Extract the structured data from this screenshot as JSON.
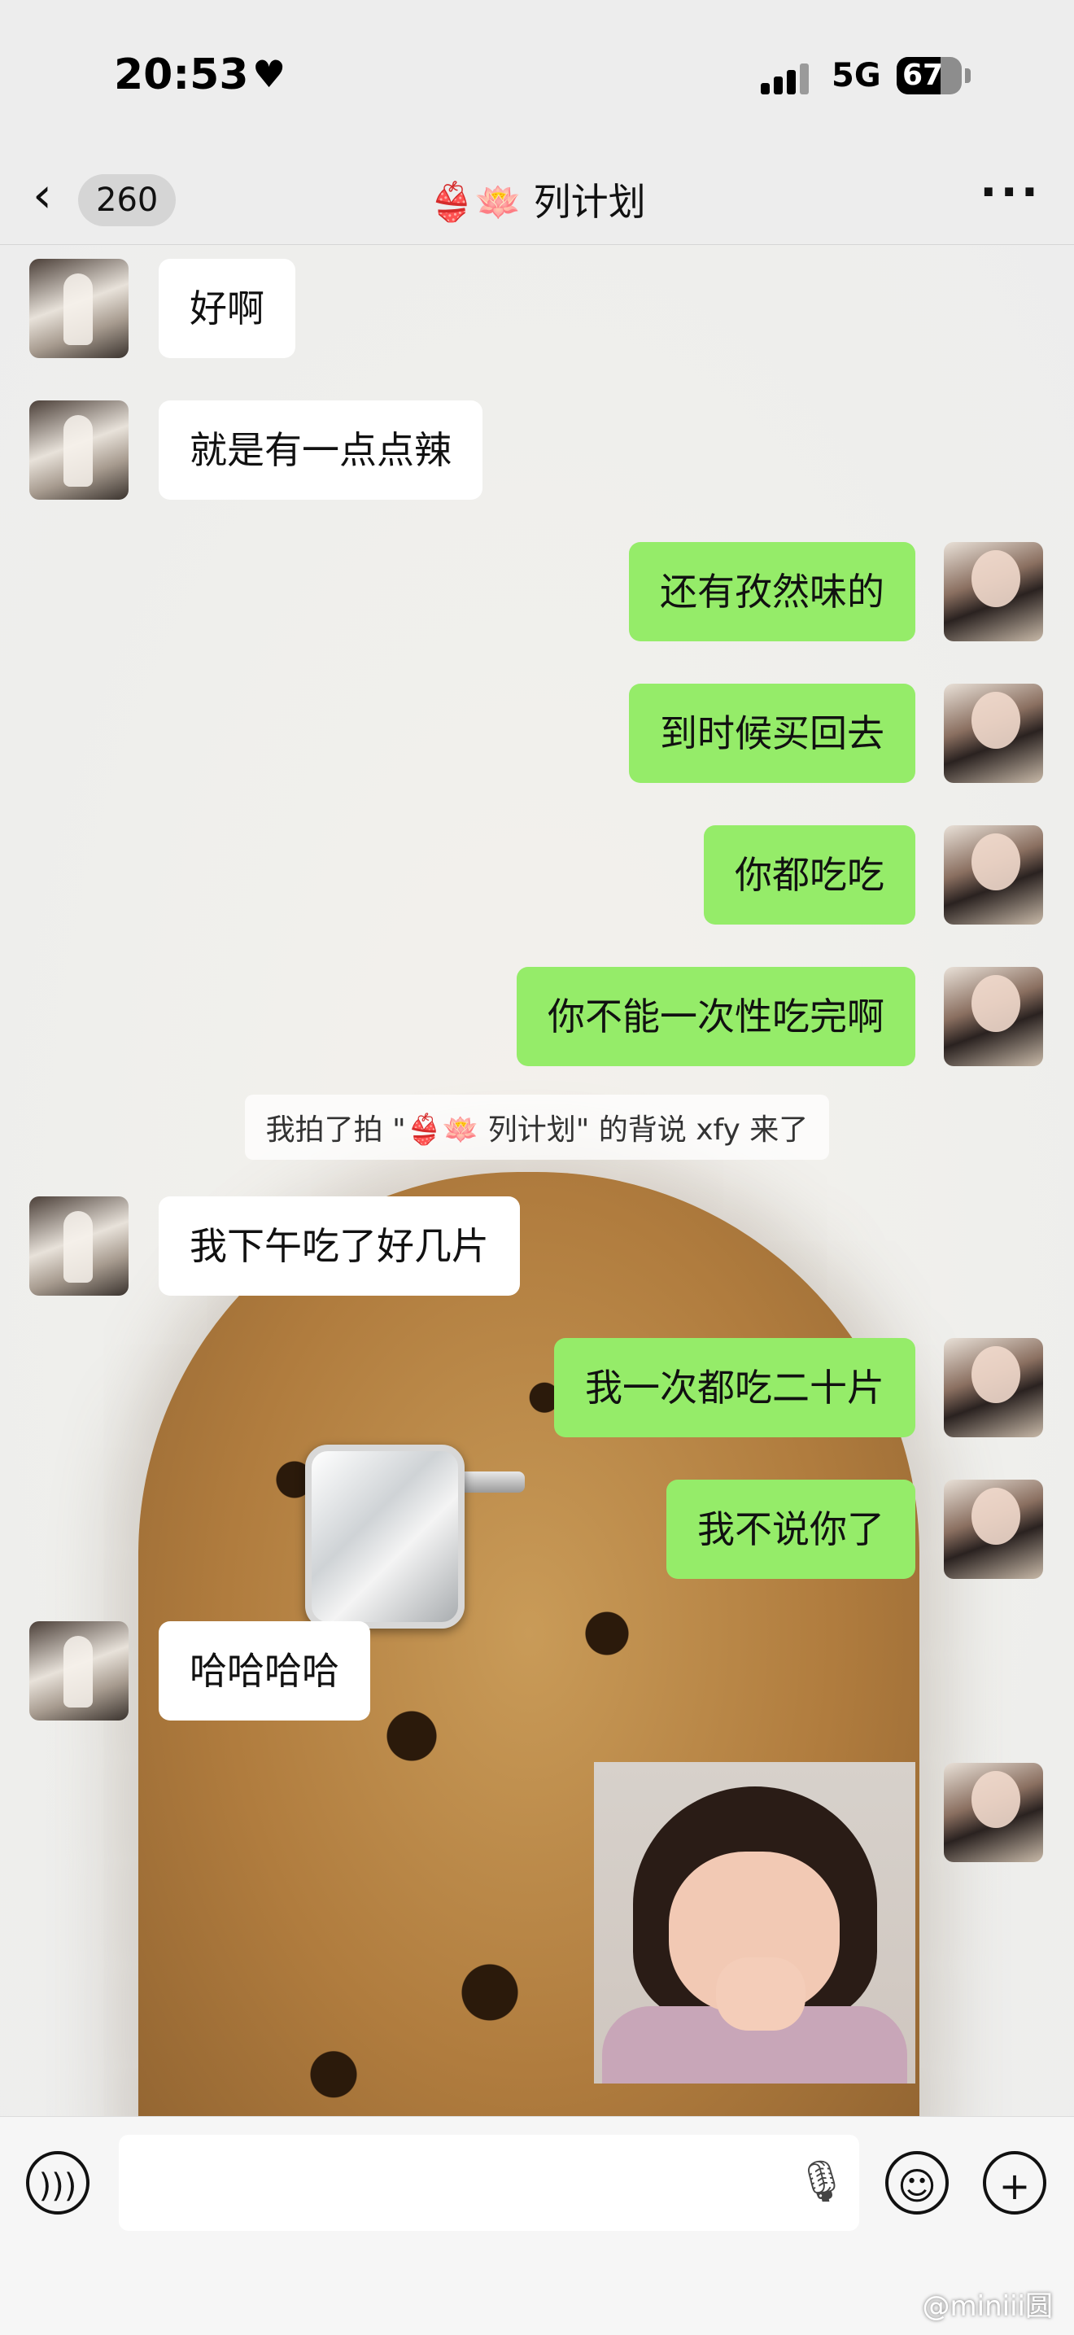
{
  "status_bar": {
    "time": "20:53",
    "heart_icon": "heart",
    "network": "5G",
    "battery": "67",
    "battery_level": 0.67
  },
  "nav": {
    "back_icon": "chevron-left",
    "unread_count": "260",
    "title": "👙🪷 列计划",
    "more_icon": "more-horizontal"
  },
  "messages": [
    {
      "side": "left",
      "text": "好啊"
    },
    {
      "side": "left",
      "text": "就是有一点点辣"
    },
    {
      "side": "right",
      "text": "还有孜然味的"
    },
    {
      "side": "right",
      "text": "到时候买回去"
    },
    {
      "side": "right",
      "text": "你都吃吃"
    },
    {
      "side": "right",
      "text": "你不能一次性吃完啊"
    },
    {
      "side": "left",
      "text": "我下午吃了好几片"
    },
    {
      "side": "right",
      "text": "我一次都吃二十片"
    },
    {
      "side": "right",
      "text": "我不说你了"
    },
    {
      "side": "left",
      "text": "哈哈哈哈"
    }
  ],
  "system_notice": "我拍了拍 \"👙🪷 列计划\" 的背说 xfy 来了",
  "input_bar": {
    "voice_icon": "voice",
    "mic_icon": "microphone",
    "emoji_icon": "emoji",
    "plus_icon": "plus"
  },
  "watermark": "@miniii圆",
  "colors": {
    "bubble_self": "#95ec69",
    "bubble_other": "#ffffff",
    "background": "#ededed"
  }
}
